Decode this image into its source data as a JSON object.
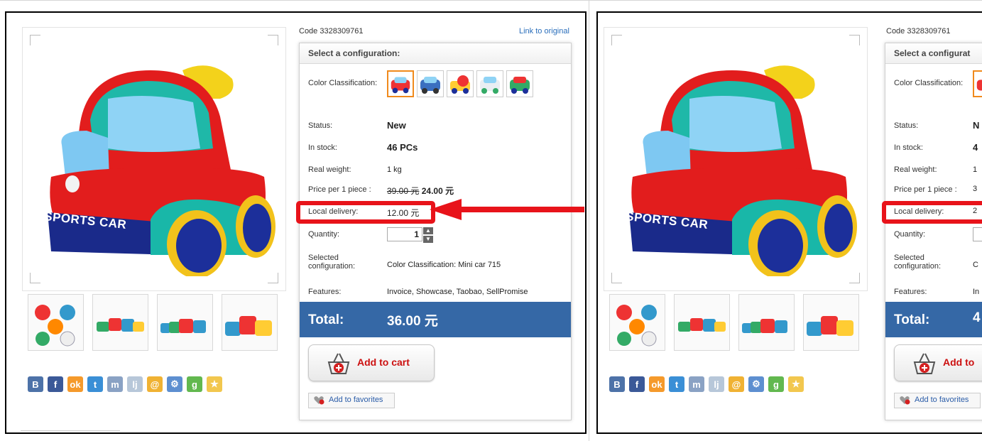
{
  "product": {
    "code_label": "Code 3328309761",
    "original_link": "Link to original",
    "config_title": "Select a configuration:",
    "color_label": "Color Classification:",
    "status_label": "Status:",
    "status_value": "New",
    "stock_label": "In stock:",
    "stock_value": "46 PCs",
    "weight_label": "Real weight:",
    "weight_value": "1 kg",
    "price_label": "Price per 1 piece :",
    "price_old": "39.00 元",
    "price_new": "24.00 元",
    "delivery_label": "Local delivery:",
    "delivery_value": "12.00 元",
    "quantity_label": "Quantity:",
    "quantity_value": "1",
    "selected_label": "Selected configuration:",
    "selected_value": "Color Classification: Mini car 715",
    "features_label": "Features:",
    "features_value": "Invoice, Showcase, Taobao, SellPromise",
    "total_label": "Total:",
    "total_value": "36.00 元",
    "cart_label": "Add to cart",
    "favorites_label": "Add to favorites",
    "main_image_text": "SPORTS CAR"
  },
  "right_panel": {
    "code_label": "Code 3328309761",
    "config_title": "Select a configurat",
    "color_label": "Color Classification:",
    "status_label": "Status:",
    "status_value": "N",
    "stock_label": "In stock:",
    "stock_value": "4",
    "weight_label": "Real weight:",
    "weight_value": "1",
    "price_label": "Price per 1 piece :",
    "price_value": "3",
    "delivery_label": "Local delivery:",
    "delivery_value": "2",
    "quantity_label": "Quantity:",
    "selected_label": "Selected configuration:",
    "selected_value": "C",
    "features_label": "Features:",
    "features_value": "In",
    "total_label": "Total:",
    "total_value": "4",
    "cart_label": "Add to",
    "favorites_label": "Add to favorites"
  },
  "social_icons": [
    {
      "name": "vk-icon",
      "letter": "B",
      "color": "#4d72a8"
    },
    {
      "name": "facebook-icon",
      "letter": "f",
      "color": "#3b5998"
    },
    {
      "name": "odnoklassniki-icon",
      "letter": "ok",
      "color": "#f59a2b"
    },
    {
      "name": "twitter-icon",
      "letter": "t",
      "color": "#3a8fd6"
    },
    {
      "name": "mailru-icon",
      "letter": "m",
      "color": "#8aa2c4"
    },
    {
      "name": "livejournal-icon",
      "letter": "lj",
      "color": "#b7c7d9"
    },
    {
      "name": "email-icon",
      "letter": "@",
      "color": "#f0b233"
    },
    {
      "name": "settings-icon",
      "letter": "⚙",
      "color": "#5d8fd0"
    },
    {
      "name": "googleplus-icon",
      "letter": "g",
      "color": "#62b84f"
    },
    {
      "name": "star-icon",
      "letter": "★",
      "color": "#f2c74e"
    }
  ],
  "colors": {
    "accent_blue": "#3568a6",
    "highlight_red": "#e8131a",
    "cart_red": "#cc1010",
    "selected_orange": "#f08a1c"
  }
}
